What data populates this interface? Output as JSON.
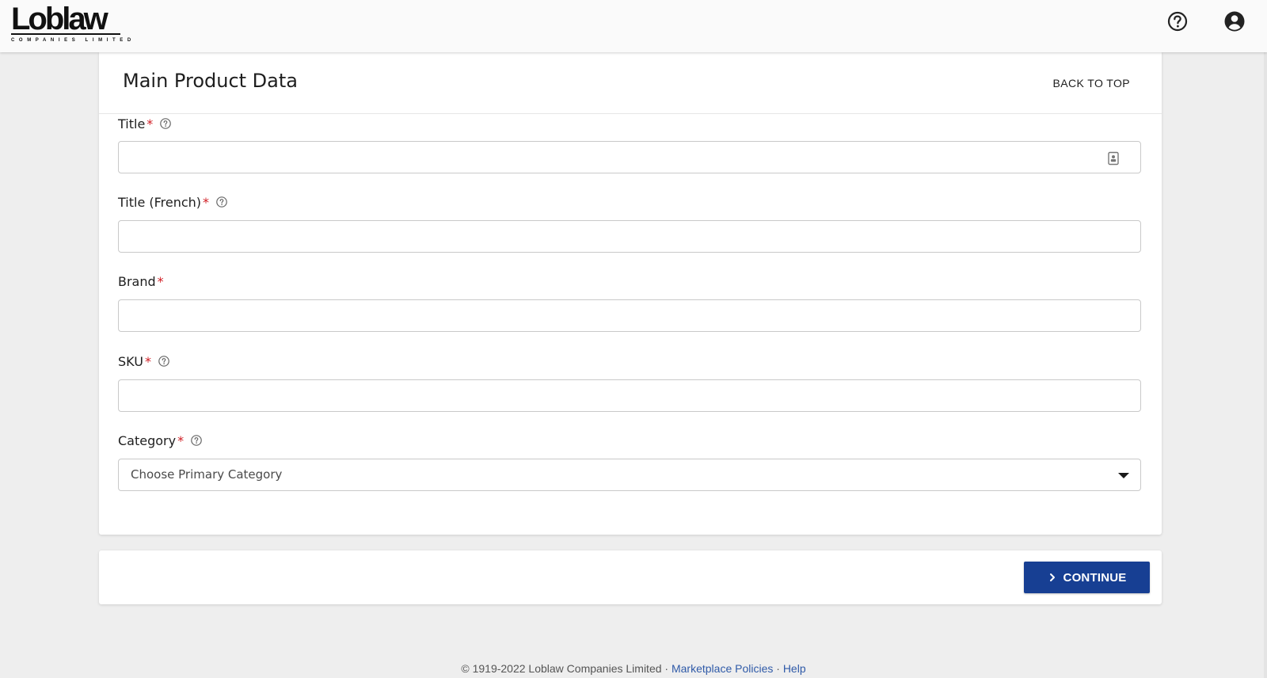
{
  "brand": {
    "name": "Loblaw",
    "subtitle": "COMPANIES LIMITED"
  },
  "topbar": {
    "help_icon": "help-circle-icon",
    "account_icon": "account-circle-icon"
  },
  "section": {
    "title": "Main Product Data",
    "back_to_top": "BACK TO TOP"
  },
  "fields": [
    {
      "label": "Title",
      "required_mark": "*",
      "has_help": true,
      "value": "",
      "adornment_icon": "contact-card-icon"
    },
    {
      "label": "Title (French)",
      "required_mark": "*",
      "has_help": true,
      "value": ""
    },
    {
      "label": "Brand",
      "required_mark": "*",
      "has_help": false,
      "value": ""
    },
    {
      "label": "SKU",
      "required_mark": "*",
      "has_help": true,
      "value": ""
    },
    {
      "label": "Category",
      "required_mark": "*",
      "has_help": true,
      "placeholder": "Choose Primary Category"
    }
  ],
  "actions": {
    "continue_label": "CONTINUE",
    "continue_icon": "chevron-right-icon"
  },
  "footer": {
    "copyright": "© 1919-2022 Loblaw Companies Limited",
    "separator": "·",
    "link_policies": "Marketplace Policies",
    "link_help": "Help"
  },
  "colors": {
    "primary": "#173f93",
    "required": "#d01c23",
    "link": "#2f5aa8",
    "page_bg": "#eeeeee"
  }
}
